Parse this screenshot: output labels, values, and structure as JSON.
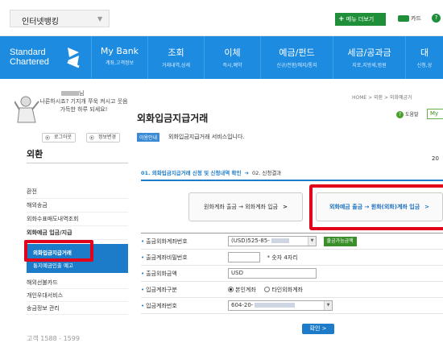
{
  "topbar": {
    "service_select": "인터넷뱅킹",
    "menu_more": "메뉴 더보기",
    "card_label": "카드"
  },
  "brand": {
    "line1": "Standard",
    "line2": "Chartered"
  },
  "nav": [
    {
      "title": "My Bank",
      "sub": "계좌,고객정보"
    },
    {
      "title": "조회",
      "sub": "거래내역,상세"
    },
    {
      "title": "이체",
      "sub": "즉시,예약"
    },
    {
      "title": "예금/펀드",
      "sub": "신규/전환/해지/통지"
    },
    {
      "title": "세금/공과금",
      "sub": "지로,지방세,범원"
    },
    {
      "title": "대",
      "sub": "신청,상"
    }
  ],
  "greeting": {
    "suffix": "님",
    "message": "나른하시죠? 기지개 쭈욱 켜시고 웃음가득한 하루 되세요!",
    "logout": "로그아웃",
    "edit_info": "정보변경"
  },
  "sidebar": {
    "title": "외환",
    "items": [
      "환전",
      "해외송금",
      "외화수표매도내역조회",
      "외화예금 입금/지급"
    ],
    "sub_active": "외화입금지급거래",
    "sub_other": "통지예금인출 예고",
    "items2": [
      "해외선불카드",
      "개인우대서비스",
      "송금정보 관리"
    ],
    "bottom": "고객   1588 - 1599"
  },
  "main": {
    "breadcrumb": "HOME > 외환 > 외화예금거",
    "title": "외화입금지급거래",
    "help": "도움말",
    "my": "My",
    "info_tag": "이용안내",
    "info_text": "외화입금지급거래 서비스입니다.",
    "year": "20",
    "step1": "01. 외화입금지급거래 신청 및 신청내역 확인",
    "step2": "02. 신청결과",
    "option_left": "원화계좌 출금 → 외화계좌 입금",
    "option_right": "외화예금 출금 → 원화(외화)계좌 입금",
    "chevron": ">",
    "confirm": "확인"
  },
  "form": {
    "fields": [
      {
        "label": "출금외화계좌번호",
        "value": "(USD)525-85-"
      },
      {
        "label": "출금계좌비밀번호",
        "value": ""
      },
      {
        "label": "출금외화금액",
        "value": "USD"
      },
      {
        "label": "입금계좌구분",
        "value": ""
      },
      {
        "label": "입금계좌번호",
        "value": "604-20-"
      }
    ],
    "check_balance": "출금가능금액",
    "pw_hint": "* 숫자 4자리",
    "radio_own": "본인계좌",
    "radio_other": "타인외화계좌"
  }
}
